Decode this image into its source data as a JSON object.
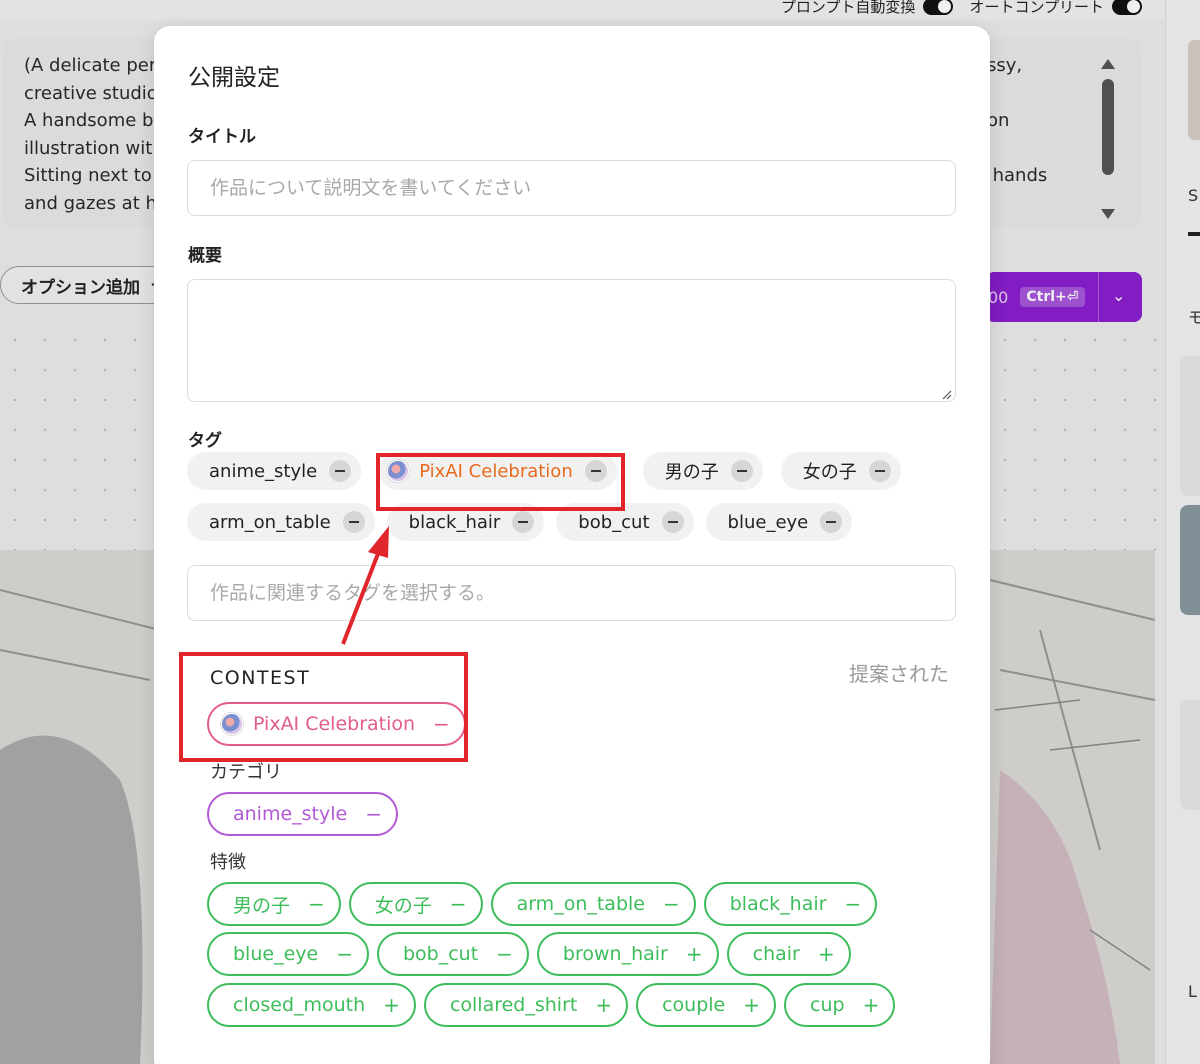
{
  "background": {
    "toggles": [
      {
        "label": "プロンプト自動変換"
      },
      {
        "label": "オートコンプリート"
      }
    ],
    "prompt_lines_left": [
      "(A delicate per",
      "creative studio",
      "A handsome b",
      "illustration wit",
      "Sitting next to",
      "and gazes at h"
    ],
    "prompt_lines_right": [
      "ssy,",
      "",
      "on",
      "",
      "her hands"
    ],
    "option_button": "オプション追加",
    "generate_count": "00",
    "generate_shortcut": "Ctrl+⏎",
    "right_texts": [
      "S",
      "モ",
      "L"
    ]
  },
  "modal": {
    "title": "公開設定",
    "title_field": {
      "label": "タイトル",
      "placeholder": "作品について説明文を書いてください"
    },
    "summary_field": {
      "label": "概要",
      "value": ""
    },
    "tags_field": {
      "label": "タグ",
      "rows": [
        [
          {
            "label": "anime_style"
          },
          {
            "label": "PixAI Celebration",
            "contest": true
          },
          {
            "label": "男の子"
          },
          {
            "label": "女の子"
          }
        ],
        [
          {
            "label": "arm_on_table"
          },
          {
            "label": "black_hair"
          },
          {
            "label": "bob_cut"
          },
          {
            "label": "blue_eye"
          }
        ]
      ],
      "placeholder": "作品に関連するタグを選択する。"
    },
    "suggestions": {
      "contest_heading": "CONTEST",
      "suggested_label": "提案された",
      "contest_chip": {
        "label": "PixAI Celebration",
        "op": "−"
      },
      "category_label": "カテゴリ",
      "category_chips": [
        {
          "label": "anime_style",
          "op": "−"
        }
      ],
      "feature_label": "特徴",
      "feature_rows": [
        [
          {
            "label": "男の子",
            "op": "−"
          },
          {
            "label": "女の子",
            "op": "−"
          },
          {
            "label": "arm_on_table",
            "op": "−"
          },
          {
            "label": "black_hair",
            "op": "−"
          }
        ],
        [
          {
            "label": "blue_eye",
            "op": "−"
          },
          {
            "label": "bob_cut",
            "op": "−"
          },
          {
            "label": "brown_hair",
            "op": "+"
          },
          {
            "label": "chair",
            "op": "+"
          }
        ],
        [
          {
            "label": "closed_mouth",
            "op": "+"
          },
          {
            "label": "collared_shirt",
            "op": "+"
          },
          {
            "label": "couple",
            "op": "+"
          },
          {
            "label": "cup",
            "op": "+"
          }
        ]
      ]
    }
  },
  "colors": {
    "accent_purple": "#8a1fcf",
    "contest_orange": "#e86a1c",
    "contest_pink": "#e45c8a",
    "category_purple": "#b25ad6",
    "feature_green": "#3dbd5a",
    "highlight_red": "#e0262b"
  }
}
